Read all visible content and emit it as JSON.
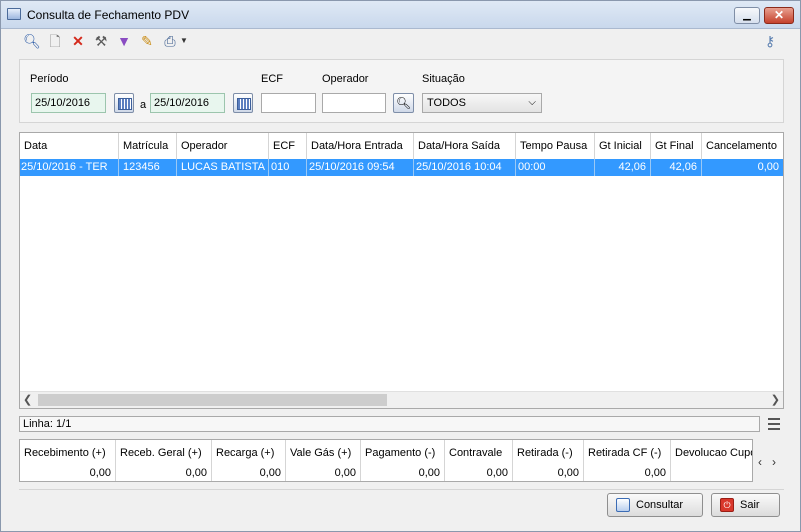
{
  "window": {
    "title": "Consulta de Fechamento PDV"
  },
  "toolbar": {
    "icons": [
      "search-icon",
      "new-document-icon",
      "delete-icon",
      "tools-icon",
      "filter-icon",
      "edit-icon",
      "print-icon",
      "key-icon"
    ]
  },
  "filters": {
    "periodo_label": "Período",
    "date_from": "25/10/2016",
    "a_label": "a",
    "date_to": "25/10/2016",
    "ecf_label": "ECF",
    "ecf_value": "",
    "operador_label": "Operador",
    "operador_value": "",
    "situacao_label": "Situação",
    "situacao_value": "TODOS"
  },
  "grid": {
    "columns": [
      "Data",
      "Matrícula",
      "Operador",
      "ECF",
      "Data/Hora Entrada",
      "Data/Hora Saída",
      "Tempo Pausa",
      "Gt Inicial",
      "Gt Final",
      "Cancelamento"
    ],
    "rows": [
      [
        "25/10/2016 - TER",
        "123456",
        "LUCAS BATISTA",
        "010",
        "25/10/2016 09:54",
        "25/10/2016 10:04",
        "00:00",
        "42,06",
        "42,06",
        "0,00"
      ]
    ]
  },
  "status": {
    "linha": "Linha: 1/1"
  },
  "totals": {
    "columns": [
      "Recebimento (+)",
      "Receb. Geral (+)",
      "Recarga (+)",
      "Vale Gás (+)",
      "Pagamento (-)",
      "Contravale",
      "Retirada (-)",
      "Retirada CF (-)",
      "Devolucao Cupom"
    ],
    "values": [
      "0,00",
      "0,00",
      "0,00",
      "0,00",
      "0,00",
      "0,00",
      "0,00",
      "0,00",
      ""
    ]
  },
  "buttons": {
    "consultar": "Consultar",
    "sair": "Sair"
  },
  "colors": {
    "selection": "#3399ff",
    "date_field": "#e8f6ee",
    "close_button": "#c5412c"
  }
}
